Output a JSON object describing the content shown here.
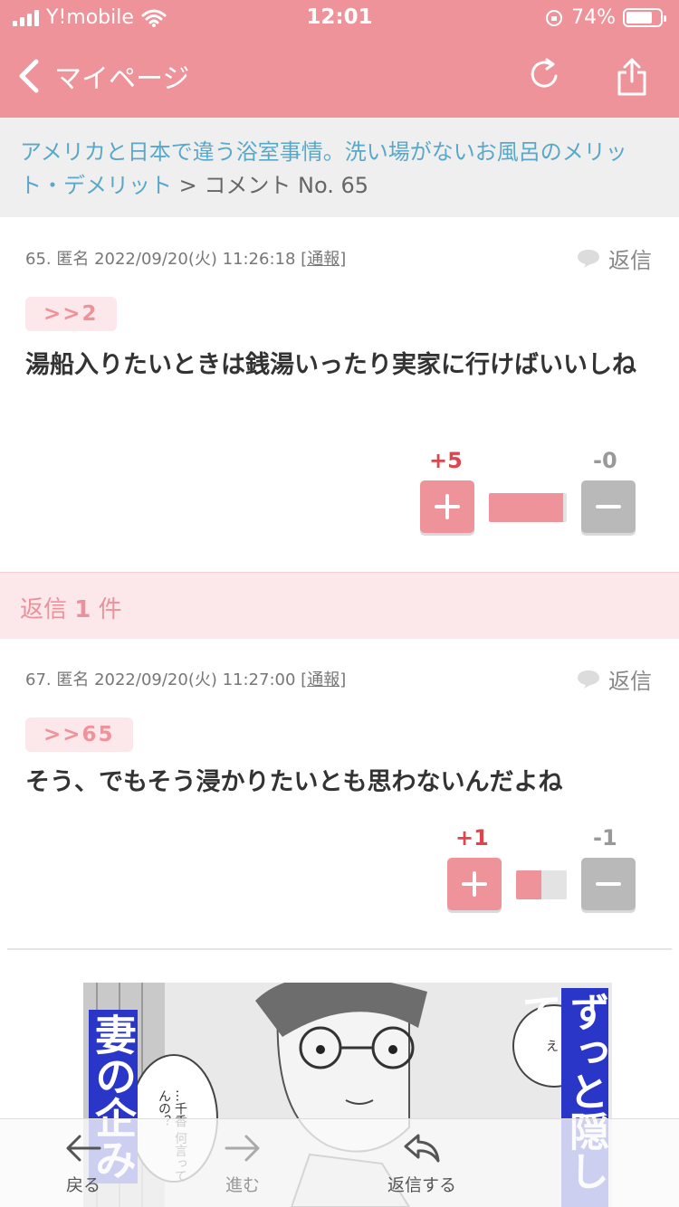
{
  "status_bar": {
    "carrier": "Y!mobile",
    "time": "12:01",
    "battery": "74%"
  },
  "nav": {
    "back_label": "マイページ"
  },
  "breadcrumb": {
    "link_text": "アメリカと日本で違う浴室事情。洗い場がないお風呂のメリット・デメリット",
    "separator": ">",
    "current": "コメント No. 65"
  },
  "comments": [
    {
      "meta": "65. 匿名 2022/09/20(火) 11:26:18",
      "report": "[通報]",
      "reply_label": "返信",
      "anchor": ">>2",
      "body": "湯船入りたいときは銭湯いったり実家に行けばいいしね",
      "plus": "+5",
      "minus": "-0",
      "ratio": 1.0
    },
    {
      "meta": "67. 匿名 2022/09/20(火) 11:27:00",
      "report": "[通報]",
      "reply_label": "返信",
      "anchor": ">>65",
      "body": "そう、でもそう浸かりたいとも思わないんだよね",
      "plus": "+1",
      "minus": "-1",
      "ratio": 0.5
    }
  ],
  "replies": {
    "prefix": "返信",
    "count": "1",
    "suffix": "件"
  },
  "ad": {
    "headline_left": "妻の企み",
    "headline_right": "ずっと隠して",
    "bubble_right": "え",
    "bubble_left": "…千香 何言ってんの？"
  },
  "toolbar": {
    "back": "戻る",
    "forward": "進む",
    "reply": "返信する"
  },
  "colors": {
    "accent": "#ef939a",
    "plus_score": "#e0444f",
    "link": "#5aa8c8"
  }
}
